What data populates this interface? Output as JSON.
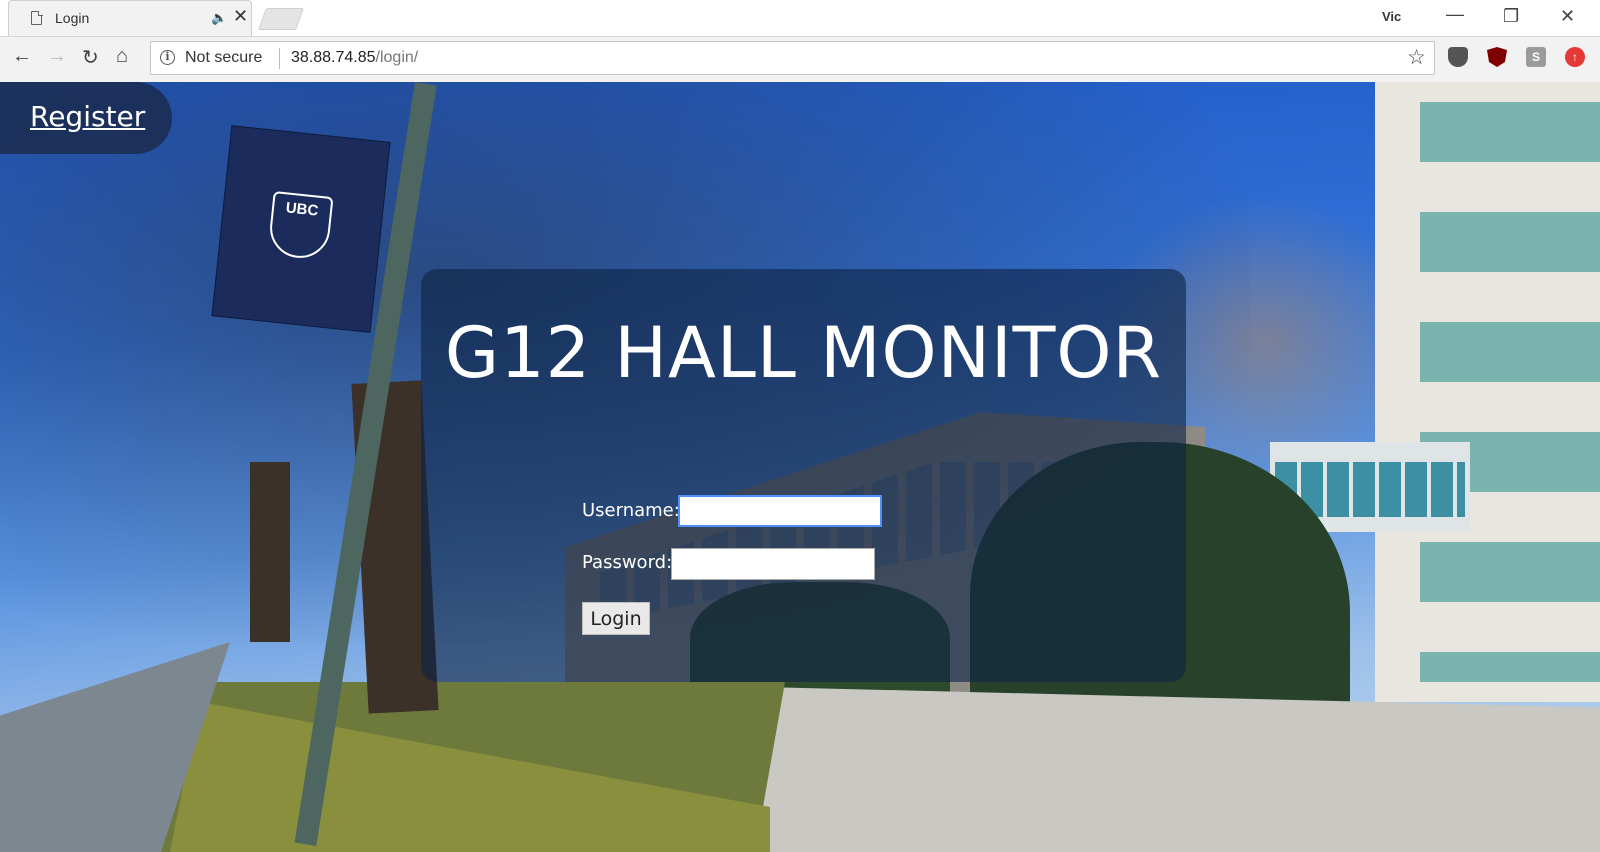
{
  "browser": {
    "tab_title": "Login",
    "profile_name": "Vic",
    "security_label": "Not secure",
    "url_host": "38.88.74.85",
    "url_path": "/login/",
    "extension_s_label": "S"
  },
  "page": {
    "register_link": "Register",
    "title": "G12 HALL MONITOR",
    "username_label": "Username:",
    "password_label": "Password:",
    "username_value": "",
    "password_value": "",
    "login_button": "Login",
    "banner_text": "UBC"
  }
}
